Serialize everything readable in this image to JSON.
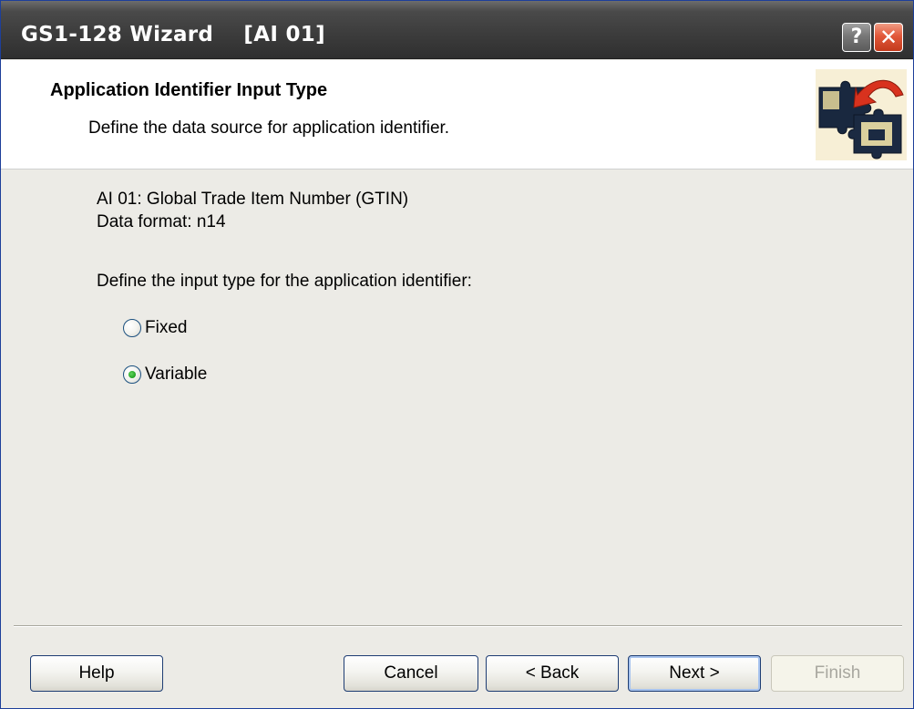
{
  "window": {
    "title": "GS1-128 Wizard    [AI 01]",
    "help_glyph": "?",
    "close_glyph": "✕"
  },
  "header": {
    "title": "Application Identifier Input Type",
    "subtitle": "Define the data source for application identifier.",
    "icon": "puzzle-piece-icon"
  },
  "content": {
    "ai_name": "AI 01: Global Trade Item Number (GTIN)",
    "data_format": "Data format: n14",
    "prompt": "Define the input type for the application identifier:",
    "options": [
      {
        "label": "Fixed",
        "selected": false
      },
      {
        "label": "Variable",
        "selected": true
      }
    ]
  },
  "buttons": {
    "help": "Help",
    "cancel": "Cancel",
    "back": "< Back",
    "next": "Next >",
    "finish": "Finish",
    "finish_disabled": true
  },
  "colors": {
    "titlebar": "#3d3d3d",
    "content_bg": "#ecebe6",
    "button_border": "#1e3d73",
    "radio_selected": "#21a121"
  }
}
